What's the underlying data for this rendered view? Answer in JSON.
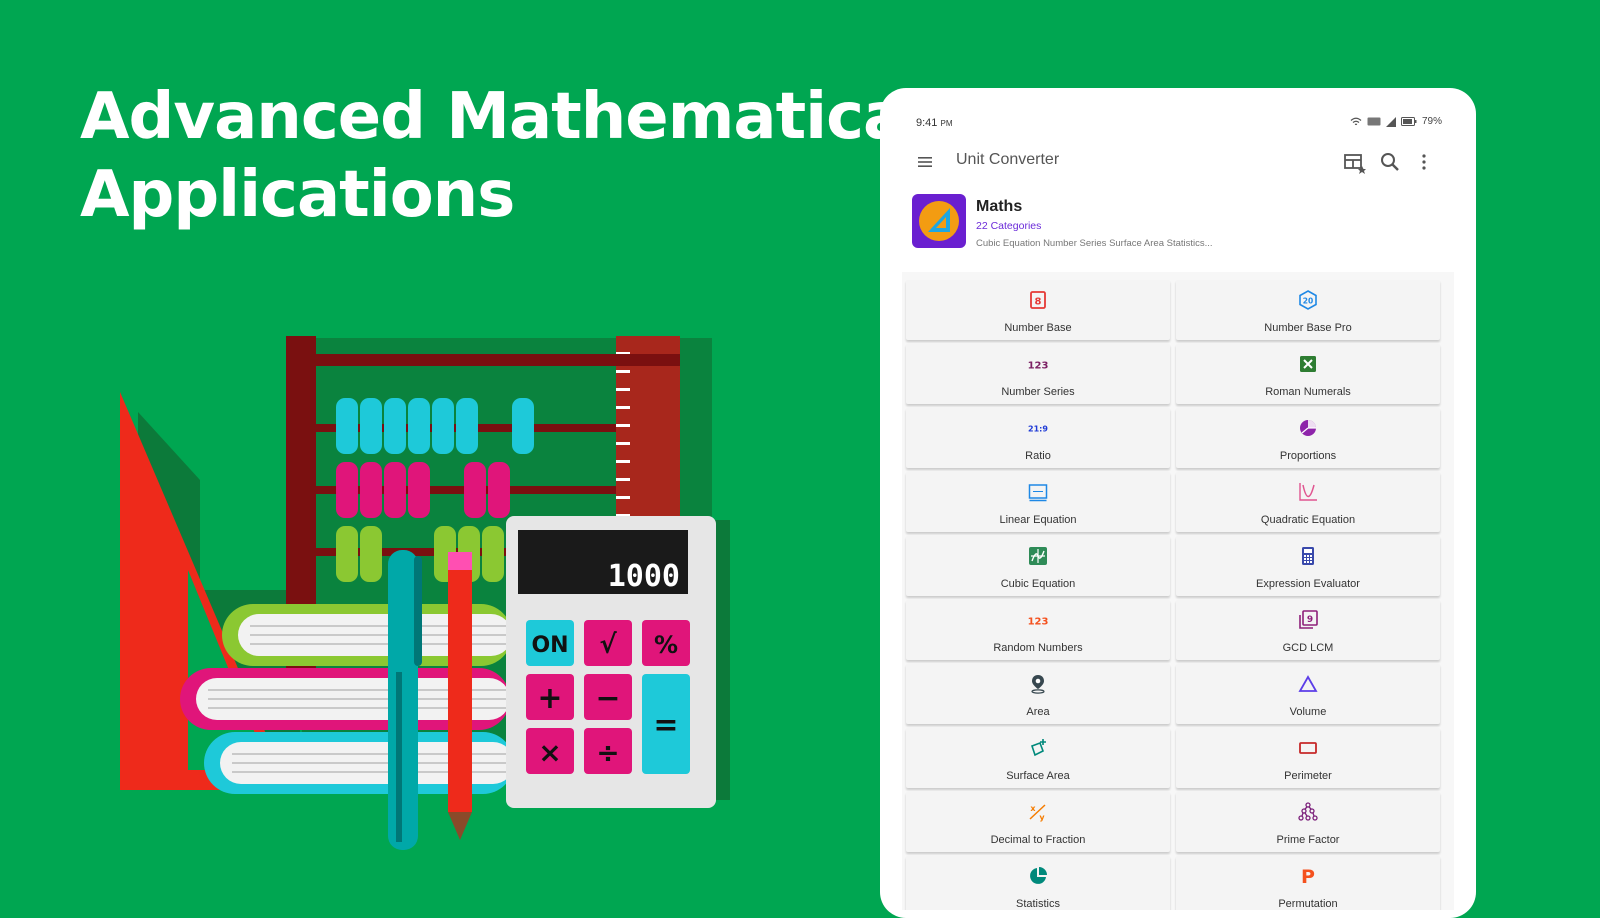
{
  "headline": {
    "line1": "Advanced Mathematical",
    "line2": "Applications"
  },
  "illustration": {
    "calculator_display": "1000",
    "keys": [
      "ON",
      "√",
      "%",
      "+",
      "−",
      "=",
      "×",
      "÷"
    ]
  },
  "status_bar": {
    "time": "9:41",
    "ampm": "PM",
    "battery": "79%"
  },
  "app_bar": {
    "title": "Unit Converter",
    "icons": [
      "menu-icon",
      "layout-icon",
      "search-icon",
      "more-icon"
    ]
  },
  "category": {
    "name": "Maths",
    "count": "22 Categories",
    "description": "Cubic Equation Number Series Surface Area Statistics..."
  },
  "tools": [
    {
      "label": "Number Base",
      "icon": "number-base-icon",
      "color": "#e53935"
    },
    {
      "label": "Number Base Pro",
      "icon": "number-base-pro-icon",
      "color": "#1e88e5"
    },
    {
      "label": "Number Series",
      "icon": "number-series-icon",
      "color": "#7b1f63"
    },
    {
      "label": "Roman Numerals",
      "icon": "roman-numerals-icon",
      "color": "#2e7d32"
    },
    {
      "label": "Ratio",
      "icon": "ratio-icon",
      "color": "#1e3ad6"
    },
    {
      "label": "Proportions",
      "icon": "proportions-icon",
      "color": "#8e24aa"
    },
    {
      "label": "Linear Equation",
      "icon": "linear-equation-icon",
      "color": "#1e88e5"
    },
    {
      "label": "Quadratic Equation",
      "icon": "quadratic-equation-icon",
      "color": "#e05590"
    },
    {
      "label": "Cubic Equation",
      "icon": "cubic-equation-icon",
      "color": "#2e8b57"
    },
    {
      "label": "Expression Evaluator",
      "icon": "expression-evaluator-icon",
      "color": "#3949ab"
    },
    {
      "label": "Random Numbers",
      "icon": "random-numbers-icon",
      "color": "#f4511e"
    },
    {
      "label": "GCD LCM",
      "icon": "gcd-lcm-icon",
      "color": "#8e1f7a"
    },
    {
      "label": "Area",
      "icon": "area-icon",
      "color": "#37474f"
    },
    {
      "label": "Volume",
      "icon": "volume-icon",
      "color": "#5c3ee8"
    },
    {
      "label": "Surface Area",
      "icon": "surface-area-icon",
      "color": "#00897b"
    },
    {
      "label": "Perimeter",
      "icon": "perimeter-icon",
      "color": "#c62828"
    },
    {
      "label": "Decimal to Fraction",
      "icon": "decimal-to-fraction-icon",
      "color": "#f57c00"
    },
    {
      "label": "Prime Factor",
      "icon": "prime-factor-icon",
      "color": "#7b1f7a"
    },
    {
      "label": "Statistics",
      "icon": "statistics-icon",
      "color": "#00897b"
    },
    {
      "label": "Permutation",
      "icon": "permutation-icon",
      "color": "#f4511e"
    }
  ]
}
